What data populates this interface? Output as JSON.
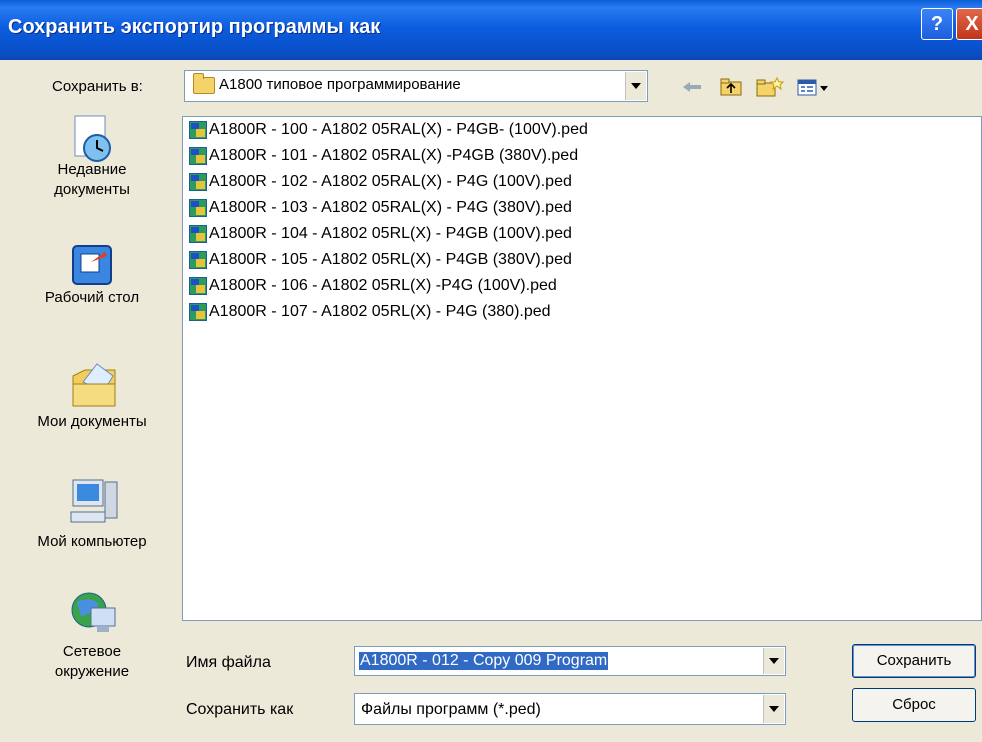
{
  "window": {
    "title": "Сохранить экспортир программы как"
  },
  "titlebar_buttons": {
    "help": "?",
    "close": "X"
  },
  "save_in": {
    "label": "Сохранить в:",
    "value": "A1800 типовое программирование"
  },
  "toolbar": {
    "back_icon": "back-arrow-icon",
    "up_icon": "up-folder-icon",
    "new_folder_icon": "new-folder-icon",
    "views_icon": "views-menu-icon"
  },
  "places": [
    {
      "label_line1": "Недавние",
      "label_line2": "документы",
      "icon": "recent-documents-icon"
    },
    {
      "label_line1": "Рабочий стол",
      "label_line2": "",
      "icon": "desktop-icon"
    },
    {
      "label_line1": "Мои документы",
      "label_line2": "",
      "icon": "my-documents-icon"
    },
    {
      "label_line1": "Мой компьютер",
      "label_line2": "",
      "icon": "my-computer-icon"
    },
    {
      "label_line1": "Сетевое",
      "label_line2": "окружение",
      "icon": "network-icon"
    }
  ],
  "files": [
    "A1800R - 100 - A1802 05RAL(X) - P4GB- (100V).ped",
    "A1800R - 101 - A1802 05RAL(X) -P4GB (380V).ped",
    "A1800R - 102 - A1802 05RAL(X) - P4G (100V).ped",
    "A1800R - 103 - A1802 05RAL(X) - P4G (380V).ped",
    "A1800R - 104 - A1802 05RL(X) - P4GB (100V).ped",
    "A1800R - 105 - A1802 05RL(X) - P4GB (380V).ped",
    "A1800R - 106 - A1802 05RL(X) -P4G  (100V).ped",
    "A1800R - 107 - A1802 05RL(X) - P4G (380).ped"
  ],
  "filename": {
    "label": "Имя файла",
    "value": "A1800R - 012 - Copy 009 Program"
  },
  "savetype": {
    "label": "Сохранить как",
    "value": "Файлы программ (*.ped)"
  },
  "buttons": {
    "save": "Сохранить",
    "cancel": "Сброс"
  },
  "colors": {
    "titlebar": "#0a5fd8",
    "selection": "#316ac5",
    "dialog_bg": "#ece9d8"
  }
}
